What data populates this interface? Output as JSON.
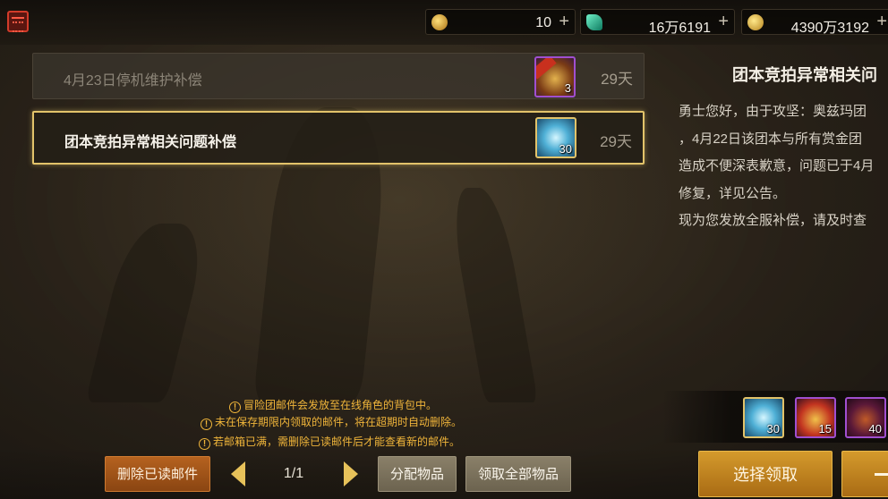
{
  "topbar": {
    "currencies": [
      {
        "icon": "c-coin-icon",
        "value": "10",
        "plus": "+"
      },
      {
        "icon": "green-gem-icon",
        "value": "16万6191",
        "plus": "+"
      },
      {
        "icon": "gold-coin-icon",
        "value": "4390万3192",
        "plus": "+"
      }
    ]
  },
  "mail_list": [
    {
      "title": "4月23日停机维护补偿",
      "days": "29天",
      "item_count": "3",
      "item_tag": "",
      "state": "read"
    },
    {
      "title": "团本竞拍异常相关问题补偿",
      "days": "29天",
      "item_count": "30",
      "item_tag": "",
      "state": "selected"
    }
  ],
  "detail": {
    "title": "团本竞拍异常相关问",
    "body_lines": [
      "勇士您好，由于攻坚：奥兹玛团",
      "，4月22日该团本与所有赏金团",
      "造成不便深表歉意，问题已于4月",
      "修复，详见公告。",
      "现为您发放全服补偿，请及时查"
    ],
    "attachments": [
      {
        "icon": "crystal-cluster-icon",
        "count": "30"
      },
      {
        "icon": "ticket-scroll-icon",
        "count": "15"
      },
      {
        "icon": "purple-orb-icon",
        "count": "40"
      }
    ]
  },
  "notices": [
    "冒险团邮件会发放至在线角色的背包中。",
    "未在保存期限内领取的邮件，将在超期时自动删除。",
    "若邮箱已满，需删除已读邮件后才能查看新的邮件。"
  ],
  "notice_mark": "!",
  "bottom": {
    "delete_read": "删除已读邮件",
    "page": "1/1",
    "distribute": "分配物品",
    "claim_all": "领取全部物品",
    "select_claim": "选择领取"
  },
  "colors": {
    "accent_gold": "#e2c36a",
    "notice_orange": "#f0b53a",
    "delete_button": "#b5621f"
  }
}
